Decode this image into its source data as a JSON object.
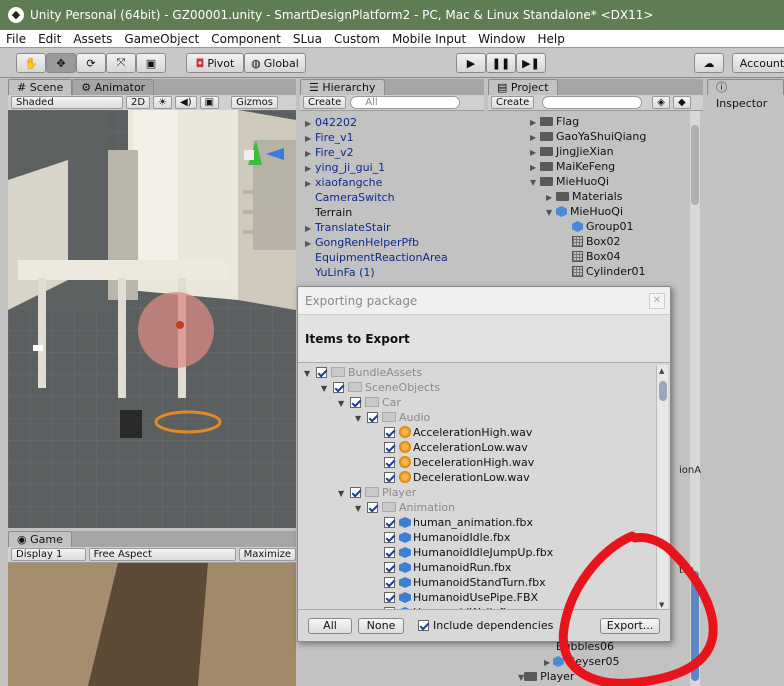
{
  "window": {
    "title": "Unity Personal (64bit) - GZ00001.unity - SmartDesignPlatform2 - PC, Mac & Linux Standalone* <DX11>"
  },
  "menu": [
    "File",
    "Edit",
    "Assets",
    "GameObject",
    "Component",
    "SLua",
    "Custom",
    "Mobile Input",
    "Window",
    "Help"
  ],
  "toolbar": {
    "pivot": "Pivot",
    "global": "Global",
    "account": "Account"
  },
  "scene": {
    "tabs": [
      "Scene",
      "Animator"
    ],
    "shading": "Shaded",
    "mode2d": "2D",
    "gizmos": "Gizmos"
  },
  "game": {
    "tab": "Game",
    "display": "Display 1",
    "aspect": "Free Aspect",
    "maximize": "Maximize"
  },
  "hierarchy": {
    "tab": "Hierarchy",
    "create": "Create",
    "search_placeholder": "All",
    "items": [
      {
        "label": "042202",
        "arrow": true
      },
      {
        "label": "Fire_v1",
        "arrow": true
      },
      {
        "label": "Fire_v2",
        "arrow": true
      },
      {
        "label": "ying_ji_gui_1",
        "arrow": true
      },
      {
        "label": "xiaofangche",
        "arrow": true
      },
      {
        "label": "CameraSwitch",
        "arrow": false
      },
      {
        "label": "Terrain",
        "arrow": false
      },
      {
        "label": "TranslateStair",
        "arrow": true
      },
      {
        "label": "GongRenHelperPfb",
        "arrow": true
      },
      {
        "label": "EquipmentReactionArea",
        "arrow": false
      },
      {
        "label": "YuLinFa (1)",
        "arrow": false
      }
    ]
  },
  "project": {
    "tab": "Project",
    "create": "Create",
    "items": [
      {
        "label": "Flag",
        "type": "folder",
        "arrow": "right"
      },
      {
        "label": "GaoYaShuiQiang",
        "type": "folder",
        "arrow": "right"
      },
      {
        "label": "JingJieXian",
        "type": "folder",
        "arrow": "right"
      },
      {
        "label": "MaiKeFeng",
        "type": "folder",
        "arrow": "right"
      },
      {
        "label": "MieHuoQi",
        "type": "folder",
        "arrow": "down"
      },
      {
        "label": "Materials",
        "type": "folder",
        "arrow": "right"
      },
      {
        "label": "MieHuoQi",
        "type": "prefab",
        "arrow": "down"
      },
      {
        "label": "Group01",
        "type": "prefab",
        "arrow": ""
      },
      {
        "label": "Box02",
        "type": "mesh",
        "arrow": ""
      },
      {
        "label": "Box04",
        "type": "mesh",
        "arrow": ""
      },
      {
        "label": "Cylinder01",
        "type": "mesh",
        "arrow": ""
      }
    ],
    "bottom_items": [
      "Bubbles06",
      "Geyser05",
      "Player"
    ]
  },
  "inspector": {
    "tab": "Inspector"
  },
  "export_dialog": {
    "title": "Exporting package",
    "heading": "Items to Export",
    "items": [
      {
        "label": "BundleAssets",
        "depth": 0,
        "kind": "folder",
        "tri": true
      },
      {
        "label": "SceneObjects",
        "depth": 1,
        "kind": "folder",
        "tri": true
      },
      {
        "label": "Car",
        "depth": 2,
        "kind": "folder",
        "tri": true
      },
      {
        "label": "Audio",
        "depth": 3,
        "kind": "folder",
        "tri": true
      },
      {
        "label": "AccelerationHigh.wav",
        "depth": 4,
        "kind": "audio",
        "tri": false
      },
      {
        "label": "AccelerationLow.wav",
        "depth": 4,
        "kind": "audio",
        "tri": false
      },
      {
        "label": "DecelerationHigh.wav",
        "depth": 4,
        "kind": "audio",
        "tri": false
      },
      {
        "label": "DecelerationLow.wav",
        "depth": 4,
        "kind": "audio",
        "tri": false
      },
      {
        "label": "Player",
        "depth": 2,
        "kind": "folder",
        "tri": true
      },
      {
        "label": "Animation",
        "depth": 3,
        "kind": "folder",
        "tri": true
      },
      {
        "label": "human_animation.fbx",
        "depth": 4,
        "kind": "fbx",
        "tri": false
      },
      {
        "label": "HumanoidIdle.fbx",
        "depth": 4,
        "kind": "fbx",
        "tri": false
      },
      {
        "label": "HumanoidIdleJumpUp.fbx",
        "depth": 4,
        "kind": "fbx",
        "tri": false
      },
      {
        "label": "HumanoidRun.fbx",
        "depth": 4,
        "kind": "fbx",
        "tri": false
      },
      {
        "label": "HumanoidStandTurn.fbx",
        "depth": 4,
        "kind": "fbx",
        "tri": false
      },
      {
        "label": "HumanoidUsePipe.FBX",
        "depth": 4,
        "kind": "fbx",
        "tri": false
      },
      {
        "label": "HumanoidWalk.fbx",
        "depth": 4,
        "kind": "fbx",
        "tri": false
      }
    ],
    "all_button": "All",
    "none_button": "None",
    "include_deps": "Include dependencies",
    "export_button": "Export..."
  },
  "colors": {
    "title_bar": "#5f7c55",
    "annotation": "#e8141c",
    "hierarchy_text": "#0e2a8a"
  }
}
